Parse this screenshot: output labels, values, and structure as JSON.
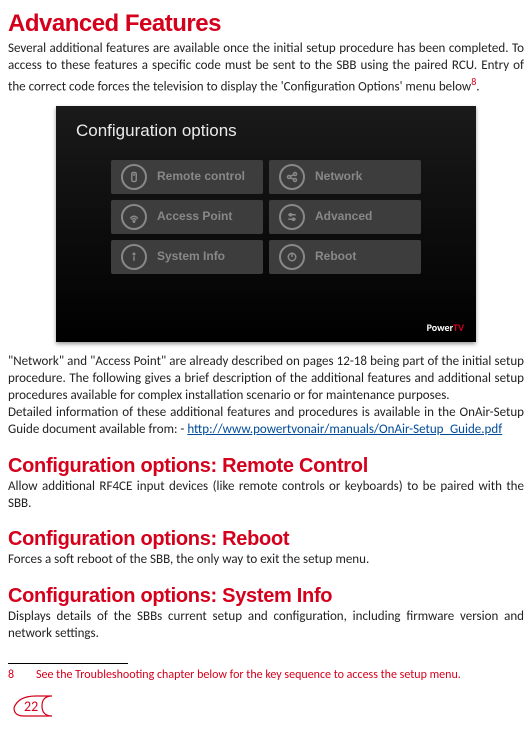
{
  "title": "Advanced Features",
  "intro": "Several additional features are available once the initial setup procedure has been completed. To access to these features a specific code must be sent to the SBB using the paired RCU. Entry of the correct code forces the television to display the 'Configuration Options' menu below",
  "intro_fn_mark": "8",
  "intro_period": ".",
  "tv": {
    "title": "Configuration options",
    "buttons": [
      {
        "label": "Remote control",
        "icon": "remote"
      },
      {
        "label": "Network",
        "icon": "network"
      },
      {
        "label": "Access Point",
        "icon": "wifi"
      },
      {
        "label": "Advanced",
        "icon": "sliders"
      },
      {
        "label": "System Info",
        "icon": "info"
      },
      {
        "label": "Reboot",
        "icon": "reboot"
      }
    ],
    "logo_power": "Power",
    "logo_tv": "TV"
  },
  "para2": "\"Network\" and \"Access Point\" are already described on pages 12-18 being part of the initial setup procedure. The following gives a brief description of the additional features and additional setup procedures available for complex installation scenario or for maintenance purposes.",
  "para3_pre": "Detailed information of these additional features and procedures is available in the OnAir-Setup Guide document available from: - ",
  "link": "http://www.powertvonair/manuals/OnAir-Setup_Guide.pdf",
  "sections": [
    {
      "heading": "Configuration options: Remote Control",
      "body": "Allow additional RF4CE input devices (like remote controls or keyboards) to be paired with the SBB."
    },
    {
      "heading": "Configuration options: Reboot",
      "body": "Forces a soft reboot of the SBB, the only way to exit the setup menu."
    },
    {
      "heading": "Configuration options: System Info",
      "body": "Displays details of the SBBs current setup and configuration, including firmware version and network settings."
    }
  ],
  "footnote_num": "8",
  "footnote_text": "See the Troubleshooting chapter below for the key sequence to access the setup menu.",
  "page_number": "22"
}
